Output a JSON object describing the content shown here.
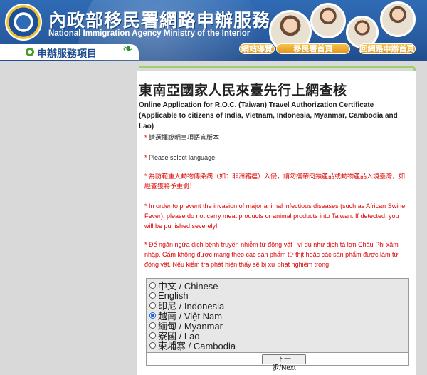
{
  "header": {
    "title_zh": "內政部移民署網路申辦服務",
    "title_en": "National Immigration Agency Ministry of the Interior",
    "section_label": "申辦服務項目",
    "nav": [
      {
        "label": "網站導覽"
      },
      {
        "label": "移民署首頁"
      },
      {
        "label": "回網路申辦首頁"
      }
    ]
  },
  "main": {
    "title": "東南亞國家人民來臺先行上網查核",
    "subtitle": "Online Application for R.O.C. (Taiwan) Travel Authorization Certificate (Applicable to citizens of India, Vietnam, Indonesia, Myanmar, Cambodia and Lao)",
    "notes": [
      {
        "star": "*",
        "text": " 請選擇說明事項語言版本",
        "color": "black"
      },
      {
        "star": "*",
        "text": " Please select language.",
        "color": "black"
      },
      {
        "star": "*",
        "text": " 為防範重大動物傳染病（如：非洲豬瘟）入侵，請勿攜帶肉類產品或動物產品入境臺灣，如經查獲將予重罰！",
        "color": "red"
      },
      {
        "star": "*",
        "text": " In order to prevent the invasion of major animal infectious diseases (such as African Swine Fever), please do not carry meat products or animal products into Taiwan. If detected, you will be punished severely!",
        "color": "red"
      },
      {
        "star": "*",
        "text": " Để ngăn ngừa dịch bệnh truyền nhiễm từ động vật , ví dụ như dịch tả lợn Châu Phi xâm nhập. Cấm không được mang theo các sản phẩm từ thịt hoặc các sản phẩm được làm từ động vật. Nếu kiểm tra phát hiện thấy sẽ bị xử phạt nghiêm trọng",
        "color": "red"
      }
    ],
    "languages": [
      {
        "label": "中文 / Chinese",
        "selected": false
      },
      {
        "label": "English",
        "selected": false
      },
      {
        "label": "印尼 / Indonesia",
        "selected": false
      },
      {
        "label": "越南 / Việt Nam",
        "selected": true
      },
      {
        "label": "緬甸 / Myanmar",
        "selected": false
      },
      {
        "label": "寮國 / Lao",
        "selected": false
      },
      {
        "label": "柬埔寨 / Cambodia",
        "selected": false
      }
    ],
    "next_label": "下一步/Next"
  }
}
